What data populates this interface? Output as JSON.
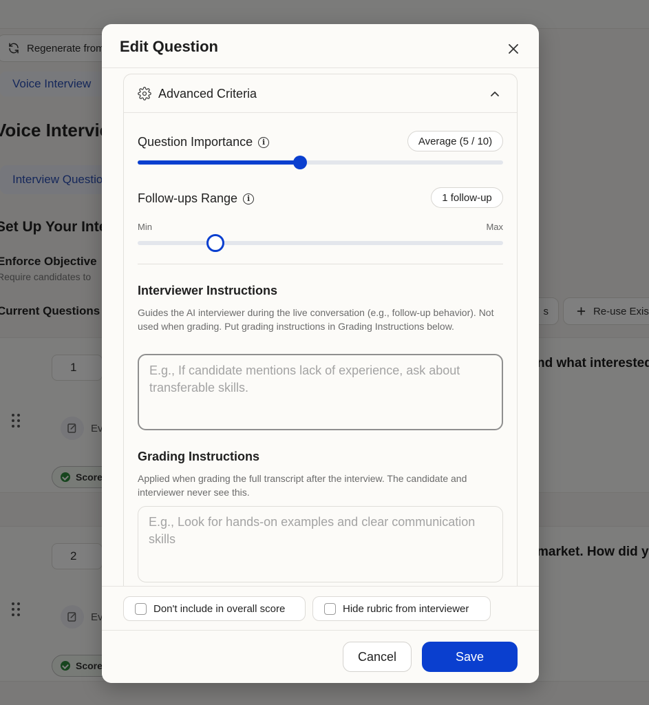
{
  "background": {
    "regenerate_label": "Regenerate from",
    "voice_link": "Voice Interview",
    "page_heading": "Voice Interview",
    "tab_label": "Interview Questions",
    "section_heading": "Set Up Your Interview",
    "enforce_label": "Enforce Objective",
    "require_text": "Require candidates to",
    "current_questions": "Current Questions",
    "small_btn_label": "s",
    "reuse_label": "Re-use Existing",
    "questions": [
      {
        "number": "1",
        "text_fragment": "nd what interested",
        "evaluate": "Ev",
        "score": "Score"
      },
      {
        "number": "2",
        "text_fragment": "market. How did y",
        "evaluate": "Ev",
        "score": "Score"
      }
    ]
  },
  "modal": {
    "title": "Edit Question",
    "section_title": "Advanced Criteria",
    "importance": {
      "label": "Question Importance",
      "badge": "Average (5 / 10)",
      "value_fraction": 0.445
    },
    "followups": {
      "label": "Follow-ups Range",
      "badge": "1 follow-up",
      "min_label": "Min",
      "max_label": "Max",
      "value_fraction": 0.213
    },
    "interviewer": {
      "title": "Interviewer Instructions",
      "help": "Guides the AI interviewer during the live conversation (e.g., follow-up behavior). Not used when grading. Put grading instructions in Grading Instructions below.",
      "placeholder": "E.g., If candidate mentions lack of experience, ask about transferable skills.",
      "value": ""
    },
    "grading": {
      "title": "Grading Instructions",
      "help": "Applied when grading the full transcript after the interview. The candidate and interviewer never see this.",
      "placeholder": "E.g., Look for hands-on examples and clear communication skills",
      "value": ""
    },
    "options": {
      "exclude_score": "Don't include in overall score",
      "hide_rubric": "Hide rubric from interviewer"
    },
    "cancel_label": "Cancel",
    "save_label": "Save"
  },
  "colors": {
    "accent": "#0a3fcf",
    "overlay": "rgba(0,0,0,0.5)",
    "score_green": "#2e8a3d"
  },
  "icons": [
    "refresh-icon",
    "close-icon",
    "gear-icon",
    "chevron-up-icon",
    "info-icon",
    "drag-handle-icon",
    "edit-icon",
    "check-circle-icon",
    "plus-icon"
  ]
}
